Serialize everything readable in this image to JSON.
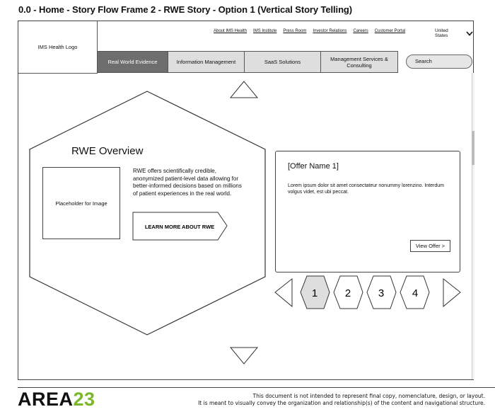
{
  "page_title": "0.0 - Home - Story Flow Frame 2 - RWE Story - Option 1 (Vertical Story Telling)",
  "header": {
    "logo": "IMS Health Logo",
    "utility_links": [
      "About IMS Health",
      "IMS Institute",
      "Press Room",
      "Investor Relations",
      "Careers",
      "Customer Portal"
    ],
    "region": "United States",
    "main_nav": [
      {
        "label": "Real World Evidence",
        "active": true
      },
      {
        "label": "Information Management",
        "active": false
      },
      {
        "label": "SaaS Solutions",
        "active": false
      },
      {
        "label": "Management Services & Consulting",
        "active": false
      }
    ],
    "search_placeholder": "Search"
  },
  "story": {
    "title": "RWE Overview",
    "image_placeholder": "Placeholder for Image",
    "description": "RWE offers scientifically credible, anonymized patient-level data allowing for better-informed decisions based on millions of patient experiences in the real world.",
    "cta": "LEARN MORE ABOUT RWE"
  },
  "offer": {
    "name": "[Offer Name 1]",
    "body": "Lorem ipsum dolor sit amet consectateur nonummy lorenzino. Interdum volgus videt, est ubi peccat.",
    "button": "View Offer >"
  },
  "pager": {
    "items": [
      "1",
      "2",
      "3",
      "4"
    ],
    "active": "1"
  },
  "footer": {
    "logo_text": "AREA",
    "logo_number": "23",
    "brand_color": "#7ab829",
    "note_line1": "This document is not intended to represent final copy, nomenclature, design, or layout.",
    "note_line2": "It is meant to visually convey the organization and relationship(s) of the content and navigational structure."
  }
}
